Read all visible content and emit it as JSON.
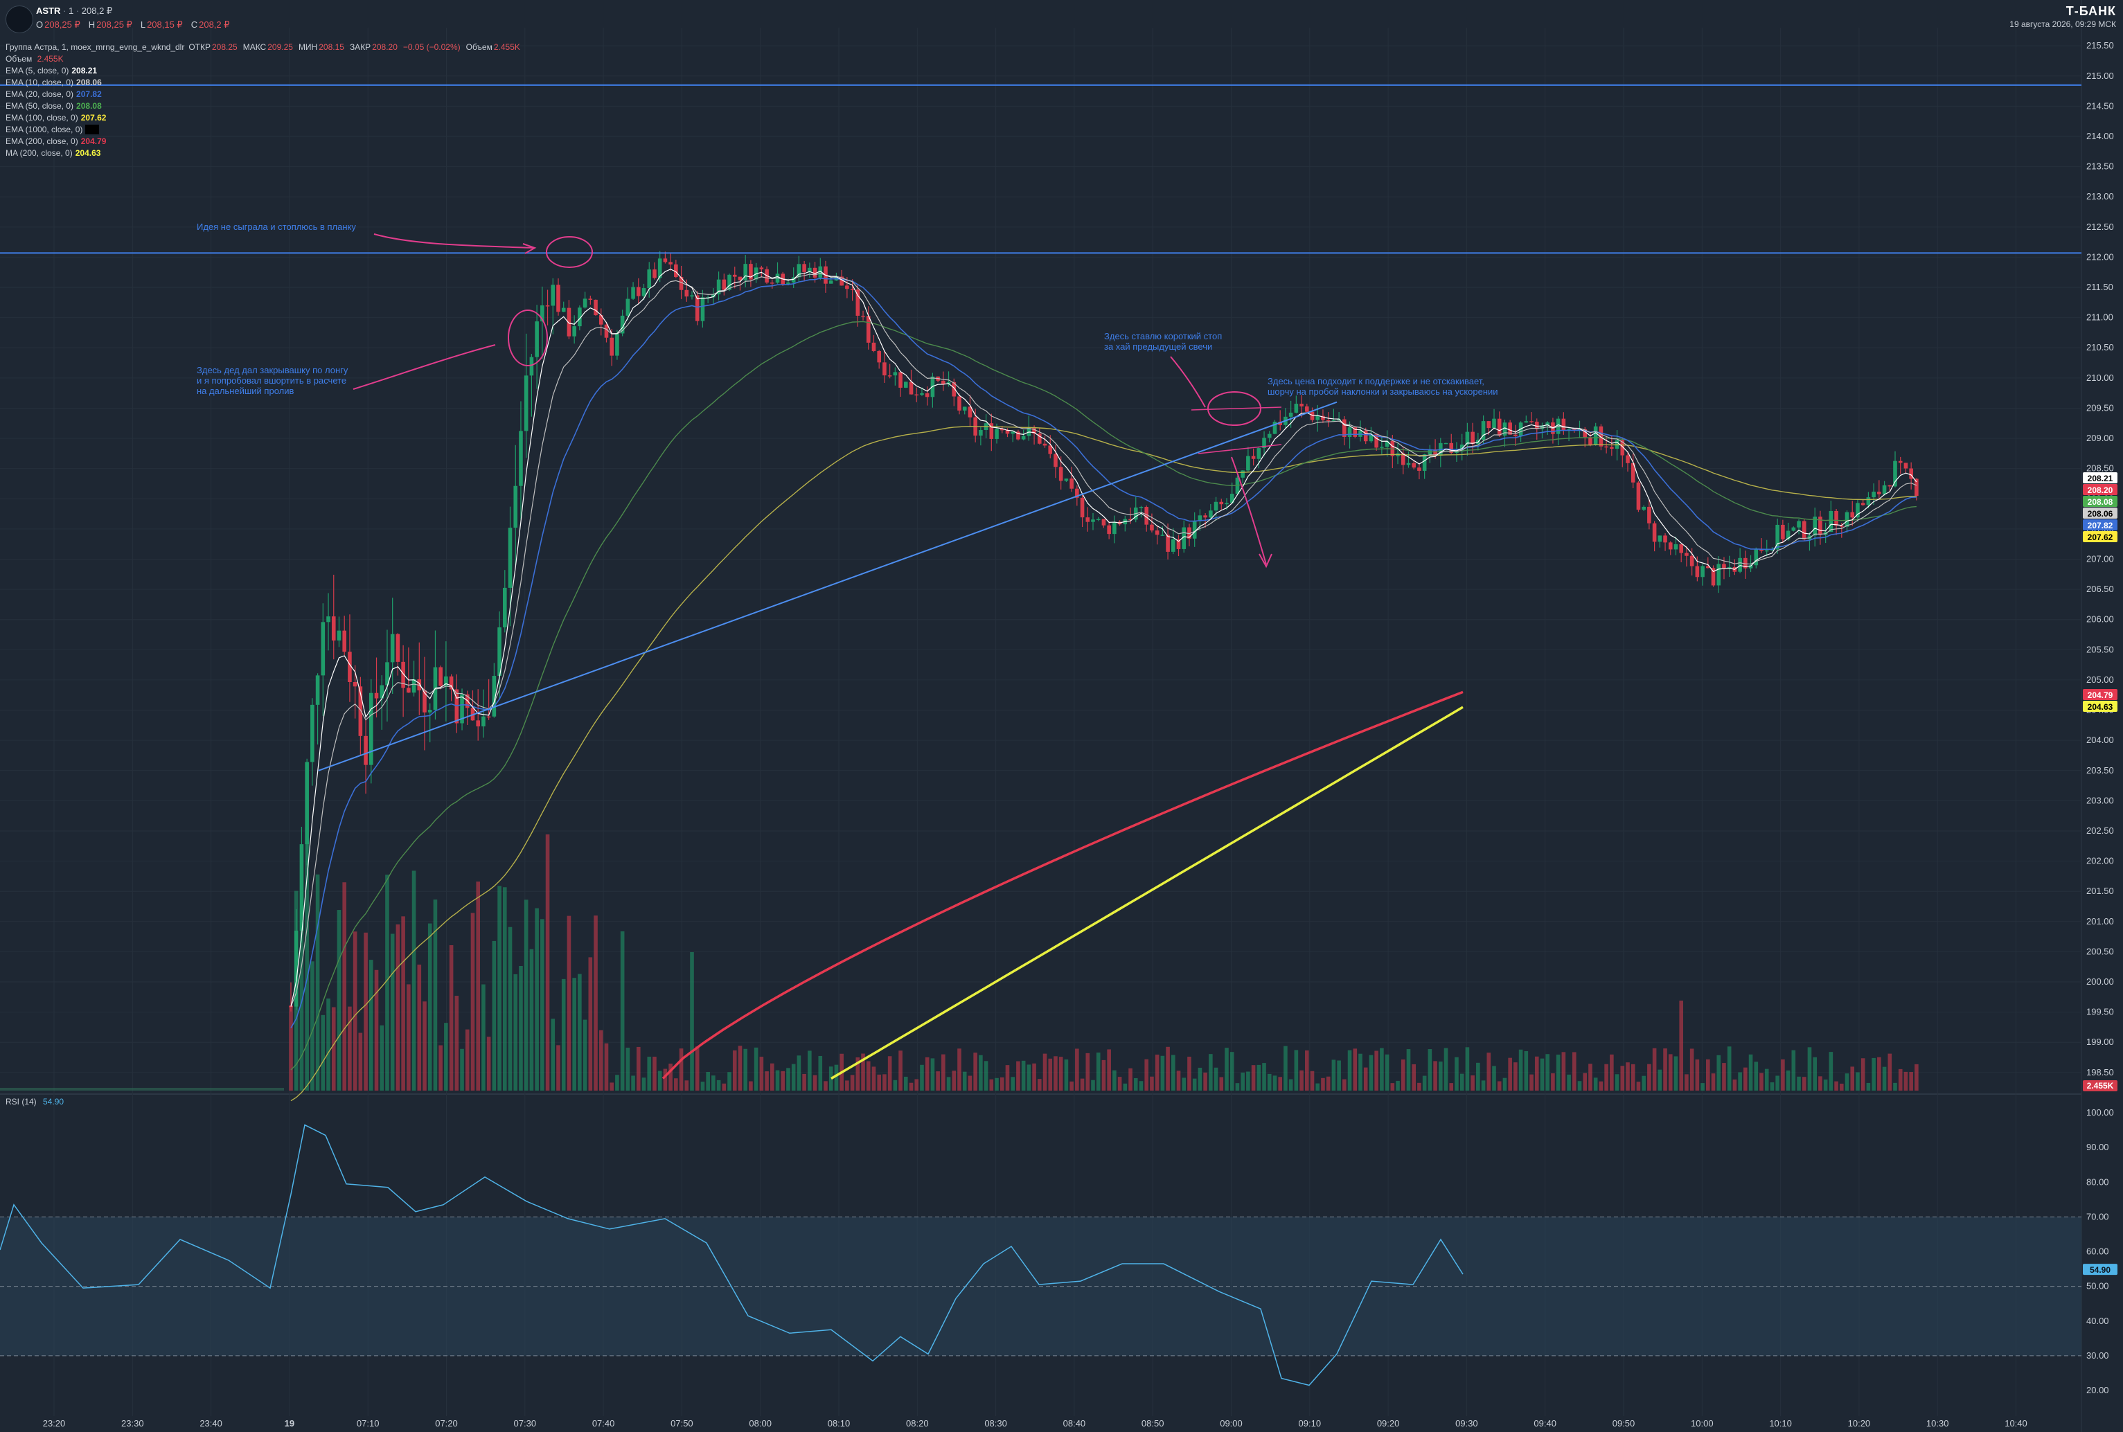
{
  "header": {
    "symbol": "ASTR",
    "interval": "1",
    "last_price": "208,2 ₽",
    "ohlc": [
      {
        "k": "O",
        "v": "208,25 ₽"
      },
      {
        "k": "H",
        "v": "208,25 ₽"
      },
      {
        "k": "L",
        "v": "208,15 ₽"
      },
      {
        "k": "C",
        "v": "208,2 ₽"
      }
    ],
    "brand": "Т-БАНК",
    "datetime": "19 августа 2026, 09:29 МСК"
  },
  "legend": {
    "group_line": {
      "prefix": "Группа Астра, 1, moex_mrng_evng_e_wknd_dlr",
      "stats": [
        {
          "k": "ОТКР",
          "v": "208.25"
        },
        {
          "k": "МАКС",
          "v": "209.25"
        },
        {
          "k": "МИН",
          "v": "208.15"
        },
        {
          "k": "ЗАКР",
          "v": "208.20"
        },
        {
          "k": "",
          "v": "−0.05 (−0.02%)"
        },
        {
          "k": "Объем",
          "v": "2.455K"
        }
      ]
    },
    "volume_label": "Объем",
    "volume_value": "2.455K",
    "indicators": [
      {
        "label": "EMA (5, close, 0)",
        "value": "208.21",
        "color": "#ffffff"
      },
      {
        "label": "EMA (10, close, 0)",
        "value": "208.06",
        "color": "#d0d0d0"
      },
      {
        "label": "EMA (20, close, 0)",
        "value": "207.82",
        "color": "#3b6fd6"
      },
      {
        "label": "EMA (50, close, 0)",
        "value": "208.08",
        "color": "#4caf50"
      },
      {
        "label": "EMA (100, close, 0)",
        "value": "207.62",
        "color": "#ffeb3b"
      },
      {
        "label": "EMA (1000, close, 0)",
        "value": "",
        "color": "#000000"
      },
      {
        "label": "EMA (200, close, 0)",
        "value": "204.79",
        "color": "#e53950"
      },
      {
        "label": "MA (200, close, 0)",
        "value": "204.63",
        "color": "#f5f542"
      }
    ]
  },
  "annotations": {
    "a1": "Идея не сыграла и стоплюсь в планку",
    "a2": "Здесь дед дал закрывашку по лонгу\nи я попробовал вшортить в расчете\nна дальнейший пролив",
    "a3": "Здесь ставлю короткий стоп\nза хай предыдущей свечи",
    "a4": "Здесь цена подходит к поддержке и не отскакивает,\nшорчу на пробой наклонки и закрываюсь на ускорении"
  },
  "rsi": {
    "label": "RSI (14)",
    "value": "54.90",
    "bands": [
      30,
      50,
      70
    ]
  },
  "colors": {
    "bg": "#1e2733",
    "up": "#1f9d6a",
    "down": "#d63b4b",
    "hline": "#3f7ee8",
    "trend": "#4d8ef0",
    "ink": "#e23d8d"
  },
  "chart_data": {
    "type": "candlestick",
    "y_range": [
      198.2,
      215.8
    ],
    "y_ticks": [
      "215.50",
      "215.00",
      "214.50",
      "214.00",
      "213.50",
      "213.00",
      "212.50",
      "212.00",
      "211.50",
      "211.00",
      "210.50",
      "210.00",
      "209.50",
      "209.00",
      "208.50",
      "208.00",
      "207.50",
      "207.00",
      "206.50",
      "206.00",
      "205.50",
      "205.00",
      "204.50",
      "204.00",
      "203.50",
      "203.00",
      "202.50",
      "202.00",
      "201.50",
      "201.00",
      "200.50",
      "200.00",
      "199.50",
      "199.00",
      "198.50"
    ],
    "x_ticks": [
      "23:20",
      "23:30",
      "23:40",
      "19",
      "07:10",
      "07:20",
      "07:30",
      "07:40",
      "07:50",
      "08:00",
      "08:10",
      "08:20",
      "08:30",
      "08:40",
      "08:50",
      "09:00",
      "09:10",
      "09:20",
      "09:30",
      "09:40",
      "09:50",
      "10:00",
      "10:10",
      "10:20",
      "10:30",
      "10:40"
    ],
    "horizontal_levels": [
      214.85,
      212.07
    ],
    "price_tags": [
      {
        "value": "208.21",
        "color": "#ffffff",
        "text_color": "#000000"
      },
      {
        "value": "208.20",
        "color": "#e53950",
        "text_color": "#ffffff"
      },
      {
        "value": "208.08",
        "color": "#4caf50",
        "text_color": "#ffffff"
      },
      {
        "value": "208.06",
        "color": "#d0d0d0",
        "text_color": "#000000"
      },
      {
        "value": "207.82",
        "color": "#3b6fd6",
        "text_color": "#ffffff"
      },
      {
        "value": "207.62",
        "color": "#ffeb3b",
        "text_color": "#000000"
      },
      {
        "value": "204.79",
        "color": "#e53950",
        "text_color": "#ffffff"
      },
      {
        "value": "204.63",
        "color": "#f5f542",
        "text_color": "#000000"
      }
    ],
    "volume_tag": "2.455K",
    "rsi_ticks": [
      "100.00",
      "90.00",
      "80.00",
      "70.00",
      "60.00",
      "50.00",
      "40.00",
      "30.00",
      "20.00"
    ],
    "rsi_tag": "54.90"
  }
}
